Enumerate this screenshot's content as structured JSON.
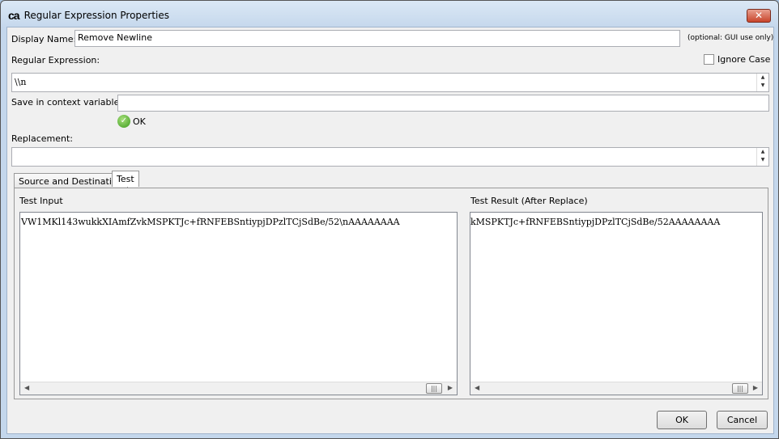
{
  "window": {
    "title": "Regular Expression Properties",
    "logo": "ca",
    "close": "✕"
  },
  "display_name": {
    "label": "Display Name:",
    "value": "Remove Newline",
    "hint": "(optional: GUI use only)"
  },
  "regex": {
    "label": "Regular Expression:",
    "value": "\\\\n",
    "ignore_case_label": "Ignore Case",
    "ignore_case": false
  },
  "context_var": {
    "label": "Save in context variable:",
    "value": "",
    "status": "OK"
  },
  "replacement": {
    "label": "Replacement:",
    "value": ""
  },
  "tabs": [
    {
      "label": "Source and Destination",
      "selected": false
    },
    {
      "label": "Test",
      "selected": true
    }
  ],
  "test": {
    "input_label": "Test Input",
    "input_value": "VW1MKl143wukkXIAmfZvkMSPKTJc+fRNFEBSntiypjDPzlTCjSdBe/52\\nAAAAAAAA",
    "result_label": "Test Result (After Replace)",
    "result_value": "kMSPKTJc+fRNFEBSntiypjDPzlTCjSdBe/52AAAAAAAA"
  },
  "buttons": {
    "ok": "OK",
    "cancel": "Cancel"
  }
}
